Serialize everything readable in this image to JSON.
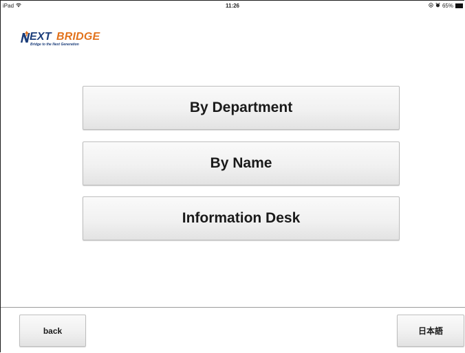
{
  "status_bar": {
    "device": "iPad",
    "time": "11:26",
    "battery": "65%",
    "wifi_icon": "wifi-icon",
    "lock_icon": "orientation-lock-icon",
    "alarm_icon": "alarm-icon",
    "battery_icon": "battery-icon"
  },
  "logo": {
    "letter_n": "N",
    "word_ext": "EXT",
    "word_bridge": "BRIDGE",
    "tagline": "Bridge to the Next Generation",
    "colors": {
      "blue": "#1b3d7a",
      "orange": "#e2721c"
    }
  },
  "menu": {
    "by_department": "By Department",
    "by_name": "By Name",
    "information_desk": "Information Desk"
  },
  "footer": {
    "back_label": "back",
    "language_label": "日本語"
  }
}
